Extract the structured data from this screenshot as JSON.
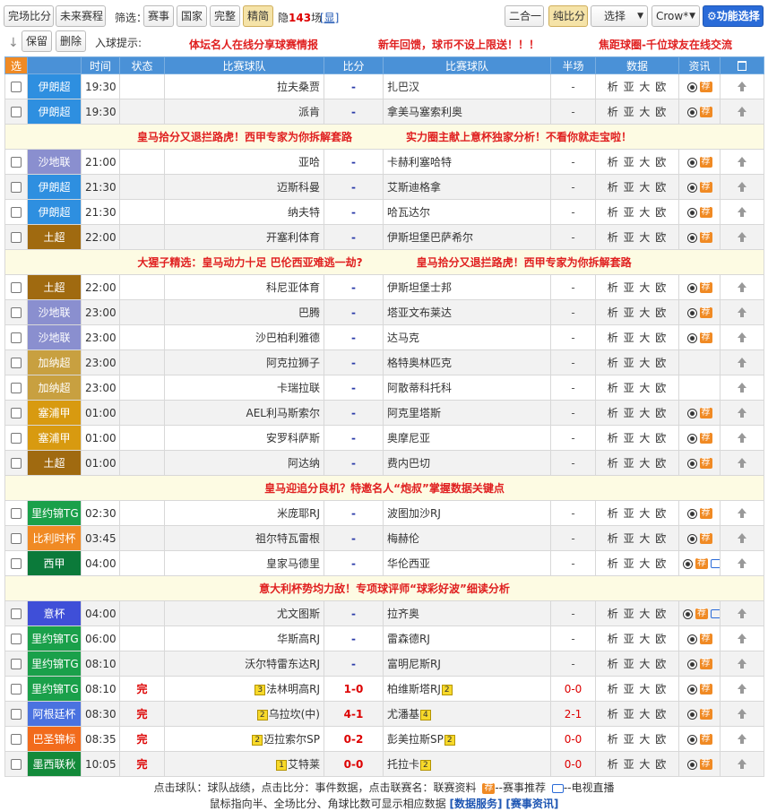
{
  "toolbar": {
    "full_score": "完场比分",
    "upcoming": "未来赛程",
    "filter_label": "筛选：",
    "filter_league": "赛事",
    "filter_country": "国家",
    "filter_full": "完整",
    "filter_featured": "精简",
    "hidden_prefix": "隐",
    "hidden_count": "143",
    "hidden_suffix": "场",
    "show_link": "[显]",
    "two_in_one": "二合一",
    "pure_score": "纯比分",
    "select_label": "选择",
    "crow_label": "Crow*",
    "function_select": "功能选择",
    "keep": "保留",
    "delete": "删除",
    "goal_hint": "入球提示:",
    "notes": [
      "体坛名人在线分享球赛情报",
      "新年回馈，球币不设上限送！！！",
      "焦距球圈-千位球友在线交流"
    ]
  },
  "columns": [
    "选",
    "时间",
    "状态",
    "比赛球队",
    "比分",
    "比赛球队",
    "半场",
    "数据",
    "资讯"
  ],
  "rows": [
    {
      "type": "match",
      "league": "伊朗超",
      "color": "#2e8fe0",
      "time": "19:30",
      "status": "",
      "home": "拉夫桑贾",
      "home_rank": "",
      "score": "-",
      "away": "扎巴汉",
      "away_rank": "",
      "half": "-",
      "data": "析 亚 大 欧",
      "tv": false
    },
    {
      "type": "match",
      "league": "伊朗超",
      "color": "#2e8fe0",
      "time": "19:30",
      "status": "",
      "home": "派肯",
      "home_rank": "",
      "score": "-",
      "away": "拿美马塞索利奥",
      "away_rank": "",
      "half": "-",
      "data": "析 亚 大 欧",
      "tv": false
    },
    {
      "type": "promo",
      "texts": [
        "皇马拾分又退拦路虎！西甲专家为你拆解套路",
        "实力圈主献上意杯独家分析！不看你就走宝啦！"
      ]
    },
    {
      "type": "match",
      "league": "沙地联",
      "color": "#8a8fcf",
      "time": "21:00",
      "status": "",
      "home": "亚哈",
      "home_rank": "",
      "score": "-",
      "away": "卡赫利塞哈特",
      "away_rank": "",
      "half": "-",
      "data": "析 亚 大 欧",
      "tv": false
    },
    {
      "type": "match",
      "league": "伊朗超",
      "color": "#2e8fe0",
      "time": "21:30",
      "status": "",
      "home": "迈斯科曼",
      "home_rank": "",
      "score": "-",
      "away": "艾斯迪格拿",
      "away_rank": "",
      "half": "-",
      "data": "析 亚 大 欧",
      "tv": false
    },
    {
      "type": "match",
      "league": "伊朗超",
      "color": "#2e8fe0",
      "time": "21:30",
      "status": "",
      "home": "纳夫特",
      "home_rank": "",
      "score": "-",
      "away": "哈瓦达尔",
      "away_rank": "",
      "half": "-",
      "data": "析 亚 大 欧",
      "tv": false
    },
    {
      "type": "match",
      "league": "土超",
      "color": "#a06a10",
      "time": "22:00",
      "status": "",
      "home": "开塞利体育",
      "home_rank": "",
      "score": "-",
      "away": "伊斯坦堡巴萨希尔",
      "away_rank": "",
      "half": "-",
      "data": "析 亚 大 欧",
      "tv": false
    },
    {
      "type": "promo",
      "texts": [
        "大猩子精选：皇马动力十足 巴伦西亚难逃一劫?",
        "皇马拾分又退拦路虎！西甲专家为你拆解套路"
      ]
    },
    {
      "type": "match",
      "league": "土超",
      "color": "#a06a10",
      "time": "22:00",
      "status": "",
      "home": "科尼亚体育",
      "home_rank": "",
      "score": "-",
      "away": "伊斯坦堡士邦",
      "away_rank": "",
      "half": "-",
      "data": "析 亚 大 欧",
      "tv": false
    },
    {
      "type": "match",
      "league": "沙地联",
      "color": "#8a8fcf",
      "time": "23:00",
      "status": "",
      "home": "巴腾",
      "home_rank": "",
      "score": "-",
      "away": "塔亚文布莱达",
      "away_rank": "",
      "half": "-",
      "data": "析 亚 大 欧",
      "tv": false
    },
    {
      "type": "match",
      "league": "沙地联",
      "color": "#8a8fcf",
      "time": "23:00",
      "status": "",
      "home": "沙巴柏利雅德",
      "home_rank": "",
      "score": "-",
      "away": "达马克",
      "away_rank": "",
      "half": "-",
      "data": "析 亚 大 欧",
      "tv": false
    },
    {
      "type": "match",
      "league": "加纳超",
      "color": "#c8a040",
      "time": "23:00",
      "status": "",
      "home": "阿克拉狮子",
      "home_rank": "",
      "score": "-",
      "away": "格特奥林匹克",
      "away_rank": "",
      "half": "-",
      "data": "析 亚 大 欧",
      "tv": false,
      "no_info": true
    },
    {
      "type": "match",
      "league": "加纳超",
      "color": "#c8a040",
      "time": "23:00",
      "status": "",
      "home": "卡瑞拉联",
      "home_rank": "",
      "score": "-",
      "away": "阿散蒂科托科",
      "away_rank": "",
      "half": "-",
      "data": "析 亚 大 欧",
      "tv": false,
      "no_info": true
    },
    {
      "type": "match",
      "league": "塞浦甲",
      "color": "#d89a10",
      "time": "01:00",
      "status": "",
      "home": "AEL利马斯索尔",
      "home_rank": "",
      "score": "-",
      "away": "阿克里塔斯",
      "away_rank": "",
      "half": "-",
      "data": "析 亚 大 欧",
      "tv": false
    },
    {
      "type": "match",
      "league": "塞浦甲",
      "color": "#d89a10",
      "time": "01:00",
      "status": "",
      "home": "安罗科萨斯",
      "home_rank": "",
      "score": "-",
      "away": "奥摩尼亚",
      "away_rank": "",
      "half": "-",
      "data": "析 亚 大 欧",
      "tv": false
    },
    {
      "type": "match",
      "league": "土超",
      "color": "#a06a10",
      "time": "01:00",
      "status": "",
      "home": "阿达纳",
      "home_rank": "",
      "score": "-",
      "away": "费内巴切",
      "away_rank": "",
      "half": "-",
      "data": "析 亚 大 欧",
      "tv": false
    },
    {
      "type": "promo",
      "texts": [
        "皇马迎追分良机？特邀名人“炮叔”掌握数据关键点"
      ]
    },
    {
      "type": "match",
      "league": "里约锦TG",
      "color": "#1aa04a",
      "time": "02:30",
      "status": "",
      "home": "米庞耶RJ",
      "home_rank": "",
      "score": "-",
      "away": "波图加沙RJ",
      "away_rank": "",
      "half": "-",
      "data": "析 亚 大 欧",
      "tv": false
    },
    {
      "type": "match",
      "league": "比利时杯",
      "color": "#f08a24",
      "time": "03:45",
      "status": "",
      "home": "祖尔特瓦雷根",
      "home_rank": "",
      "score": "-",
      "away": "梅赫伦",
      "away_rank": "",
      "half": "-",
      "data": "析 亚 大 欧",
      "tv": false
    },
    {
      "type": "match",
      "league": "西甲",
      "color": "#0b7a3a",
      "time": "04:00",
      "status": "",
      "home": "皇家马德里",
      "home_rank": "",
      "score": "-",
      "away": "华伦西亚",
      "away_rank": "",
      "half": "-",
      "data": "析 亚 大 欧",
      "tv": true
    },
    {
      "type": "promo",
      "texts": [
        "意大利杯势均力敌！专项球评师“球彩好波”细读分析"
      ]
    },
    {
      "type": "match",
      "league": "意杯",
      "color": "#3f4fd8",
      "time": "04:00",
      "status": "",
      "home": "尤文图斯",
      "home_rank": "",
      "score": "-",
      "away": "拉齐奥",
      "away_rank": "",
      "half": "-",
      "data": "析 亚 大 欧",
      "tv": true
    },
    {
      "type": "match",
      "league": "里约锦TG",
      "color": "#1aa04a",
      "time": "06:00",
      "status": "",
      "home": "华斯高RJ",
      "home_rank": "",
      "score": "-",
      "away": "雷森德RJ",
      "away_rank": "",
      "half": "-",
      "data": "析 亚 大 欧",
      "tv": false
    },
    {
      "type": "match",
      "league": "里约锦TG",
      "color": "#1aa04a",
      "time": "08:10",
      "status": "",
      "home": "沃尔特雷东达RJ",
      "home_rank": "",
      "score": "-",
      "away": "富明尼斯RJ",
      "away_rank": "",
      "half": "-",
      "data": "析 亚 大 欧",
      "tv": false
    },
    {
      "type": "match",
      "league": "里约锦TG",
      "color": "#1aa04a",
      "time": "08:10",
      "status": "完",
      "home": "法林明高RJ",
      "home_rank": "3",
      "score": "1-0",
      "away": "柏维斯塔RJ",
      "away_rank": "2",
      "half": "0-0",
      "data": "析 亚 大 欧",
      "tv": false
    },
    {
      "type": "match",
      "league": "阿根廷杯",
      "color": "#4a72e0",
      "time": "08:30",
      "status": "完",
      "home": "乌拉坎(中)",
      "home_rank": "2",
      "score": "4-1",
      "away": "尤潘基",
      "away_rank": "4",
      "half": "2-1",
      "data": "析 亚 大 欧",
      "tv": false
    },
    {
      "type": "match",
      "league": "巴圣锦标",
      "color": "#f26b1c",
      "time": "08:35",
      "status": "完",
      "home": "迈拉索尔SP",
      "home_rank": "2",
      "score": "0-2",
      "away": "彭美拉斯SP",
      "away_rank": "2",
      "half": "0-0",
      "data": "析 亚 大 欧",
      "tv": false
    },
    {
      "type": "match",
      "league": "墨西联秋",
      "color": "#138a3a",
      "time": "10:05",
      "status": "完",
      "home": "艾特莱",
      "home_rank": "1",
      "score": "0-0",
      "away": "托拉卡",
      "away_rank": "2",
      "half": "0-0",
      "data": "析 亚 大 欧",
      "tv": false
    }
  ],
  "footer": {
    "line1_a": "点击球队：球队战绩，点击比分：事件数据，点击联赛名：联赛资料",
    "line1_b": "--赛事推荐",
    "line1_c": "--电视直播",
    "line2_a": "鼠标指向半、全场比分、角球比数可显示相应数据",
    "data_service": "[数据服务]",
    "match_info": "[赛事资讯]",
    "jian": "荐"
  },
  "icons": {
    "select": "checkbox",
    "info": "ball-icon",
    "recommend": "jian-badge",
    "tv": "tv-icon",
    "top": "arrow-up-icon",
    "delete": "trash-icon",
    "settings": "gear-icon"
  }
}
